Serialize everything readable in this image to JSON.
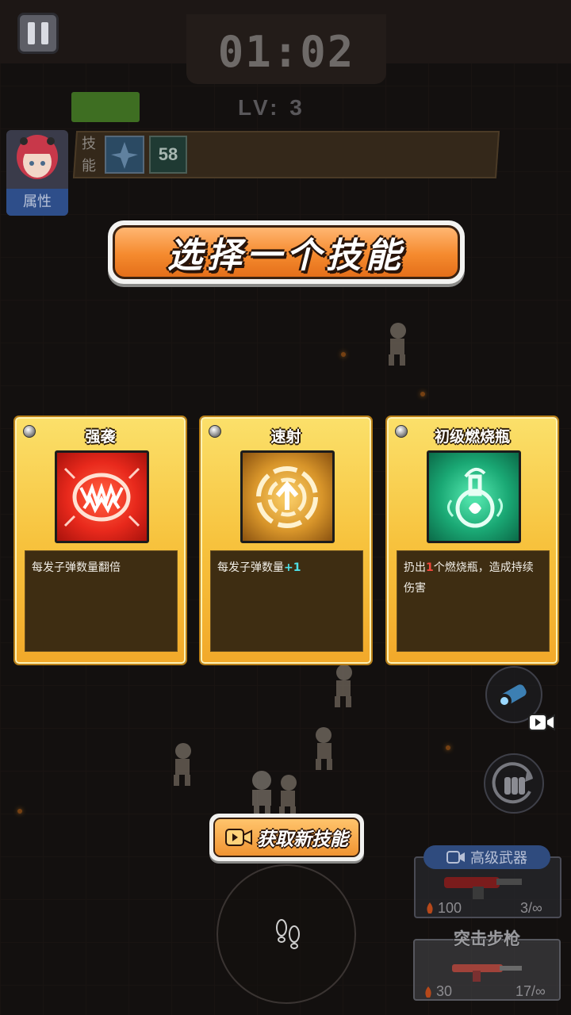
{
  "hud": {
    "timer": "01:02",
    "level": "LV: 3",
    "attribute_label": "属性",
    "skill_tag": "技能",
    "skill_slot_count": "58"
  },
  "dialog": {
    "title": "选择一个技能",
    "cards": [
      {
        "name": "强袭",
        "desc": "每发子弹数量翻倍",
        "icon": "fangs-icon",
        "color": "#e8291c"
      },
      {
        "name": "速射",
        "desc_prefix": "每发子弹数量",
        "desc_highlight": "+1",
        "desc_suffix": "",
        "icon": "crosshair-arrow-icon",
        "color": "#c9841e"
      },
      {
        "name": "初级燃烧瓶",
        "desc_prefix": "扔出",
        "desc_highlight": "1",
        "desc_suffix": "个燃烧瓶，造成持续伤害",
        "icon": "potion-flask-icon",
        "color": "#1aa874"
      }
    ],
    "get_new_skill": "获取新技能"
  },
  "weapons": {
    "advanced_label": "高级武器",
    "advanced_power": "100",
    "advanced_ammo": "3/∞",
    "current_name": "突击步枪",
    "current_power": "30",
    "current_ammo": "17/∞"
  }
}
